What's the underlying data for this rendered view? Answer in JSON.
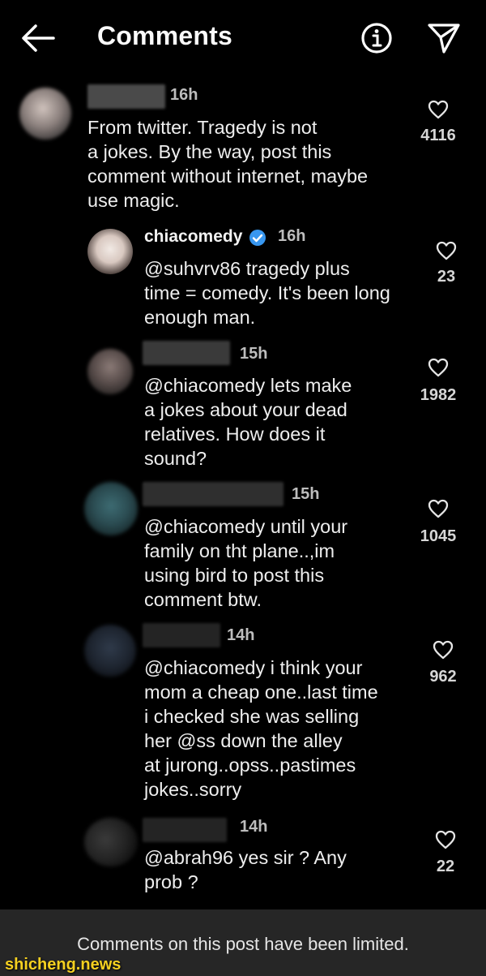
{
  "header": {
    "title": "Comments",
    "back_icon": "arrow-left-icon",
    "info_icon": "info-icon",
    "send_icon": "send-icon"
  },
  "comments": [
    {
      "time": "16h",
      "text": "From twitter. Tragedy is not\na jokes. By the way, post this\ncomment without internet, maybe\nuse magic.",
      "likes": "4116"
    },
    {
      "username": "chiacomedy",
      "time": "16h",
      "text": "@suhvrv86 tragedy plus\ntime = comedy. It's been long\nenough man.",
      "likes": "23"
    },
    {
      "time": "15h",
      "text": "@chiacomedy lets make\na jokes about your dead\nrelatives. How does it\nsound?",
      "likes": "1982"
    },
    {
      "time": "15h",
      "text": "@chiacomedy until your\nfamily on tht plane..,im\nusing bird to post this\ncomment btw.",
      "likes": "1045"
    },
    {
      "time": "14h",
      "text": "@chiacomedy i think your\nmom a cheap one..last time\ni checked she was selling\nher @ss down the alley\nat jurong..opss..pastimes\njokes..sorry",
      "likes": "962"
    },
    {
      "time": "14h",
      "text": "@abrah96 yes sir ? Any\nprob ?",
      "likes": "22"
    }
  ],
  "footer": {
    "limited_text": "Comments on this post have been limited."
  },
  "watermark": "shicheng.news",
  "colors": {
    "background": "#000000",
    "verified": "#3897f0",
    "footer_bg": "#262626",
    "watermark": "#f5d020"
  }
}
